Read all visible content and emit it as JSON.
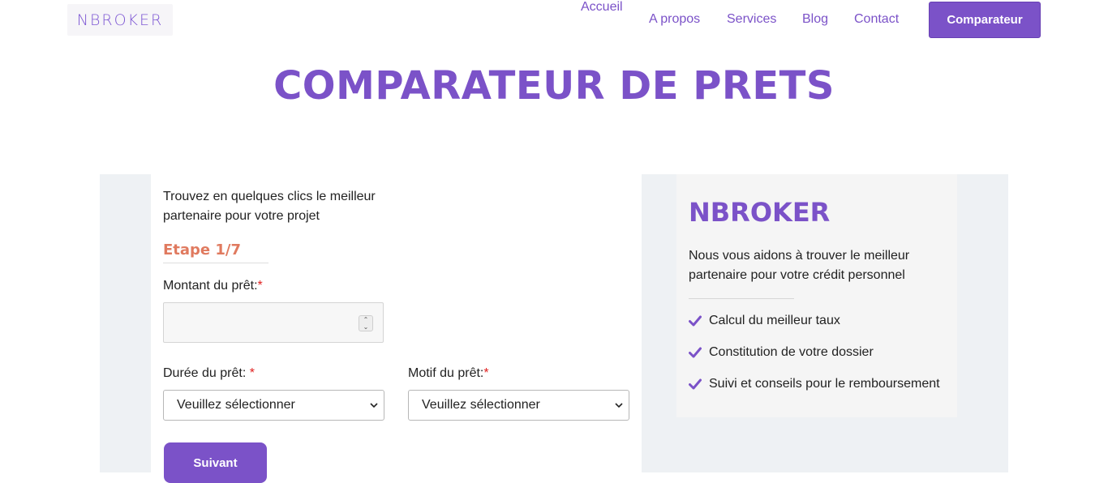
{
  "header": {
    "logo": "NBROKER",
    "nav": [
      {
        "label": "Accueil"
      },
      {
        "label": "A propos"
      },
      {
        "label": "Services"
      },
      {
        "label": "Blog"
      },
      {
        "label": "Contact"
      }
    ],
    "cta_label": "Comparateur"
  },
  "hero": {
    "title": "COMPARATEUR DE PRETS"
  },
  "form": {
    "intro": "Trouvez en quelques clics le meilleur partenaire pour votre projet",
    "step": "Etape 1/7",
    "amount_label": "Montant du prêt:",
    "amount_value": "",
    "duration_label": "Durée du prêt: ",
    "duration_selected": "Veuillez sélectionner",
    "purpose_label": "Motif du prêt:",
    "purpose_selected": "Veuillez sélectionner",
    "required_mark": "*",
    "next_label": "Suivant"
  },
  "info": {
    "title": "NBROKER",
    "text": "Nous vous aidons à trouver le meilleur partenaire pour votre crédit personnel",
    "features": [
      "Calcul du meilleur taux",
      "Constitution de votre dossier",
      "Suivi et conseils pour le remboursement"
    ]
  },
  "colors": {
    "brand": "#7b52c8",
    "step": "#e07a5f",
    "required": "#e0201f"
  },
  "icons": {
    "check": "check-icon",
    "chevron": "chevron-down-icon",
    "spinner": "number-spinner-icon"
  }
}
